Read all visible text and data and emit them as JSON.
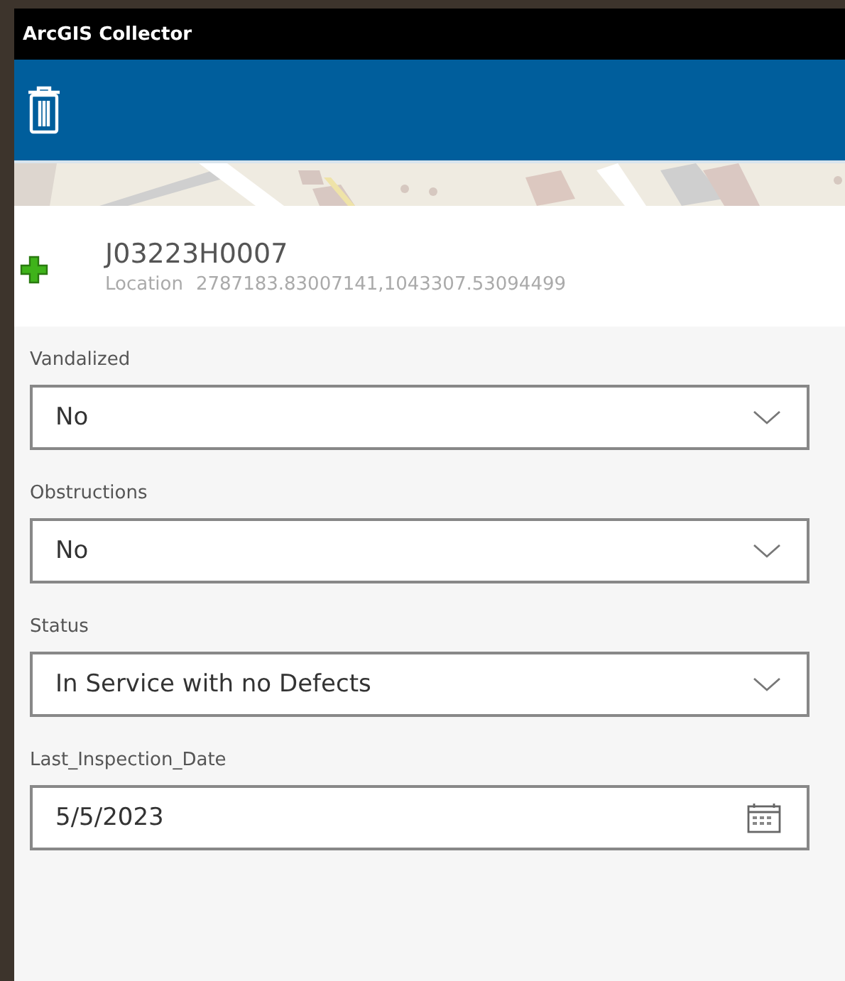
{
  "window": {
    "title": "ArcGIS Collector"
  },
  "feature": {
    "id": "J03223H0007",
    "location_label": "Location",
    "location_value": "2787183.83007141,1043307.53094499"
  },
  "fields": [
    {
      "label": "Vandalized",
      "kind": "dropdown",
      "value": "No"
    },
    {
      "label": "Obstructions",
      "kind": "dropdown",
      "value": "No"
    },
    {
      "label": "Status",
      "kind": "dropdown",
      "value": "In Service with no Defects"
    },
    {
      "label": "Last_Inspection_Date",
      "kind": "date",
      "value": "5/5/2023"
    }
  ]
}
